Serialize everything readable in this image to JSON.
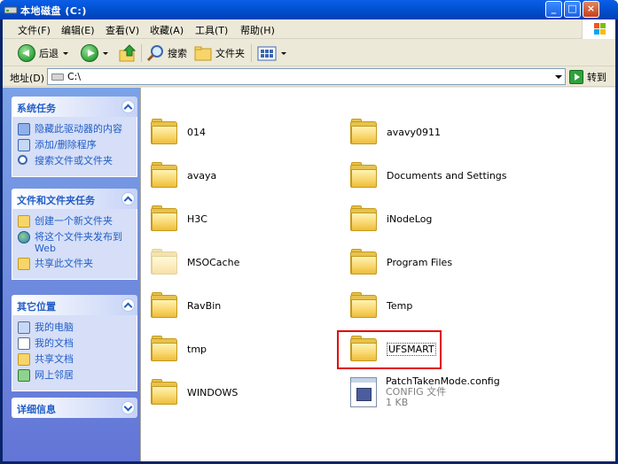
{
  "window": {
    "title": "本地磁盘 (C:)"
  },
  "menu": [
    "文件(F)",
    "编辑(E)",
    "查看(V)",
    "收藏(A)",
    "工具(T)",
    "帮助(H)"
  ],
  "toolbar": {
    "back_label": "后退",
    "search_label": "搜索",
    "folders_label": "文件夹"
  },
  "address": {
    "label": "地址(D)",
    "value": "C:\\",
    "go_label": "转到"
  },
  "taskpane": {
    "panels": [
      {
        "title": "系统任务",
        "expanded": true,
        "tasks": [
          "隐藏此驱动器的内容",
          "添加/删除程序",
          "搜索文件或文件夹"
        ]
      },
      {
        "title": "文件和文件夹任务",
        "expanded": true,
        "tasks": [
          "创建一个新文件夹",
          "将这个文件夹发布到 Web",
          "共享此文件夹"
        ]
      },
      {
        "title": "其它位置",
        "expanded": true,
        "tasks": [
          "我的电脑",
          "我的文档",
          "共享文档",
          "网上邻居"
        ]
      },
      {
        "title": "详细信息",
        "expanded": false,
        "tasks": []
      }
    ]
  },
  "files": [
    {
      "name": "014",
      "type": "folder"
    },
    {
      "name": "avavy0911",
      "type": "folder"
    },
    {
      "name": "avaya",
      "type": "folder"
    },
    {
      "name": "Documents and Settings",
      "type": "folder"
    },
    {
      "name": "H3C",
      "type": "folder"
    },
    {
      "name": "iNodeLog",
      "type": "folder"
    },
    {
      "name": "MSOCache",
      "type": "folder",
      "hidden": true
    },
    {
      "name": "Program Files",
      "type": "folder"
    },
    {
      "name": "RavBin",
      "type": "folder"
    },
    {
      "name": "Temp",
      "type": "folder"
    },
    {
      "name": "tmp",
      "type": "folder"
    },
    {
      "name": "UFSMART",
      "type": "folder",
      "highlighted": true
    },
    {
      "name": "WINDOWS",
      "type": "folder"
    },
    {
      "name": "PatchTakenMode.config",
      "type": "file",
      "file_type": "CONFIG 文件",
      "size": "1 KB"
    }
  ],
  "colors": {
    "title_bar": "#0353d4",
    "task_pane": "#6f8fe0",
    "panel_header_text": "#215dc6",
    "highlight": "#e00000",
    "folder": "#e8c24c"
  }
}
